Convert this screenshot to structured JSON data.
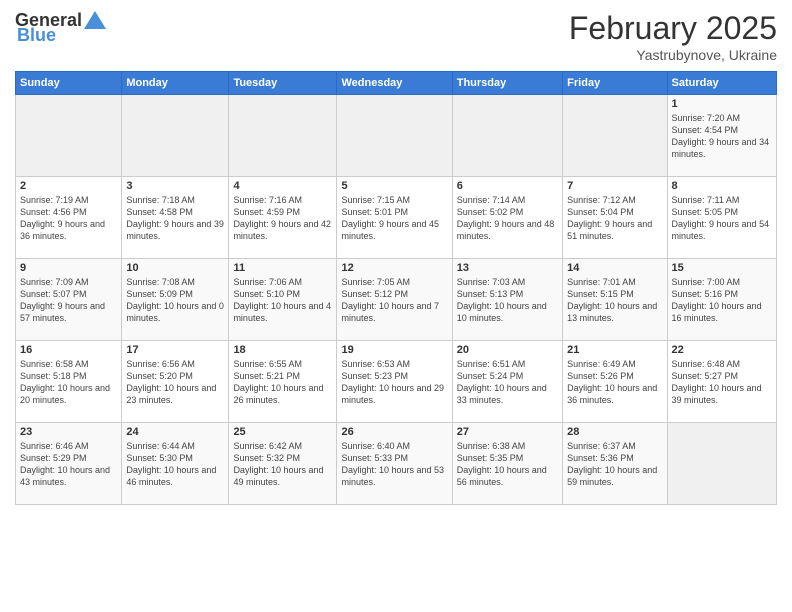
{
  "header": {
    "logo_general": "General",
    "logo_blue": "Blue",
    "month_year": "February 2025",
    "location": "Yastrubynove, Ukraine"
  },
  "days_of_week": [
    "Sunday",
    "Monday",
    "Tuesday",
    "Wednesday",
    "Thursday",
    "Friday",
    "Saturday"
  ],
  "weeks": [
    [
      {
        "day": "",
        "info": ""
      },
      {
        "day": "",
        "info": ""
      },
      {
        "day": "",
        "info": ""
      },
      {
        "day": "",
        "info": ""
      },
      {
        "day": "",
        "info": ""
      },
      {
        "day": "",
        "info": ""
      },
      {
        "day": "1",
        "info": "Sunrise: 7:20 AM\nSunset: 4:54 PM\nDaylight: 9 hours and 34 minutes."
      }
    ],
    [
      {
        "day": "2",
        "info": "Sunrise: 7:19 AM\nSunset: 4:56 PM\nDaylight: 9 hours and 36 minutes."
      },
      {
        "day": "3",
        "info": "Sunrise: 7:18 AM\nSunset: 4:58 PM\nDaylight: 9 hours and 39 minutes."
      },
      {
        "day": "4",
        "info": "Sunrise: 7:16 AM\nSunset: 4:59 PM\nDaylight: 9 hours and 42 minutes."
      },
      {
        "day": "5",
        "info": "Sunrise: 7:15 AM\nSunset: 5:01 PM\nDaylight: 9 hours and 45 minutes."
      },
      {
        "day": "6",
        "info": "Sunrise: 7:14 AM\nSunset: 5:02 PM\nDaylight: 9 hours and 48 minutes."
      },
      {
        "day": "7",
        "info": "Sunrise: 7:12 AM\nSunset: 5:04 PM\nDaylight: 9 hours and 51 minutes."
      },
      {
        "day": "8",
        "info": "Sunrise: 7:11 AM\nSunset: 5:05 PM\nDaylight: 9 hours and 54 minutes."
      }
    ],
    [
      {
        "day": "9",
        "info": "Sunrise: 7:09 AM\nSunset: 5:07 PM\nDaylight: 9 hours and 57 minutes."
      },
      {
        "day": "10",
        "info": "Sunrise: 7:08 AM\nSunset: 5:09 PM\nDaylight: 10 hours and 0 minutes."
      },
      {
        "day": "11",
        "info": "Sunrise: 7:06 AM\nSunset: 5:10 PM\nDaylight: 10 hours and 4 minutes."
      },
      {
        "day": "12",
        "info": "Sunrise: 7:05 AM\nSunset: 5:12 PM\nDaylight: 10 hours and 7 minutes."
      },
      {
        "day": "13",
        "info": "Sunrise: 7:03 AM\nSunset: 5:13 PM\nDaylight: 10 hours and 10 minutes."
      },
      {
        "day": "14",
        "info": "Sunrise: 7:01 AM\nSunset: 5:15 PM\nDaylight: 10 hours and 13 minutes."
      },
      {
        "day": "15",
        "info": "Sunrise: 7:00 AM\nSunset: 5:16 PM\nDaylight: 10 hours and 16 minutes."
      }
    ],
    [
      {
        "day": "16",
        "info": "Sunrise: 6:58 AM\nSunset: 5:18 PM\nDaylight: 10 hours and 20 minutes."
      },
      {
        "day": "17",
        "info": "Sunrise: 6:56 AM\nSunset: 5:20 PM\nDaylight: 10 hours and 23 minutes."
      },
      {
        "day": "18",
        "info": "Sunrise: 6:55 AM\nSunset: 5:21 PM\nDaylight: 10 hours and 26 minutes."
      },
      {
        "day": "19",
        "info": "Sunrise: 6:53 AM\nSunset: 5:23 PM\nDaylight: 10 hours and 29 minutes."
      },
      {
        "day": "20",
        "info": "Sunrise: 6:51 AM\nSunset: 5:24 PM\nDaylight: 10 hours and 33 minutes."
      },
      {
        "day": "21",
        "info": "Sunrise: 6:49 AM\nSunset: 5:26 PM\nDaylight: 10 hours and 36 minutes."
      },
      {
        "day": "22",
        "info": "Sunrise: 6:48 AM\nSunset: 5:27 PM\nDaylight: 10 hours and 39 minutes."
      }
    ],
    [
      {
        "day": "23",
        "info": "Sunrise: 6:46 AM\nSunset: 5:29 PM\nDaylight: 10 hours and 43 minutes."
      },
      {
        "day": "24",
        "info": "Sunrise: 6:44 AM\nSunset: 5:30 PM\nDaylight: 10 hours and 46 minutes."
      },
      {
        "day": "25",
        "info": "Sunrise: 6:42 AM\nSunset: 5:32 PM\nDaylight: 10 hours and 49 minutes."
      },
      {
        "day": "26",
        "info": "Sunrise: 6:40 AM\nSunset: 5:33 PM\nDaylight: 10 hours and 53 minutes."
      },
      {
        "day": "27",
        "info": "Sunrise: 6:38 AM\nSunset: 5:35 PM\nDaylight: 10 hours and 56 minutes."
      },
      {
        "day": "28",
        "info": "Sunrise: 6:37 AM\nSunset: 5:36 PM\nDaylight: 10 hours and 59 minutes."
      },
      {
        "day": "",
        "info": ""
      }
    ]
  ]
}
